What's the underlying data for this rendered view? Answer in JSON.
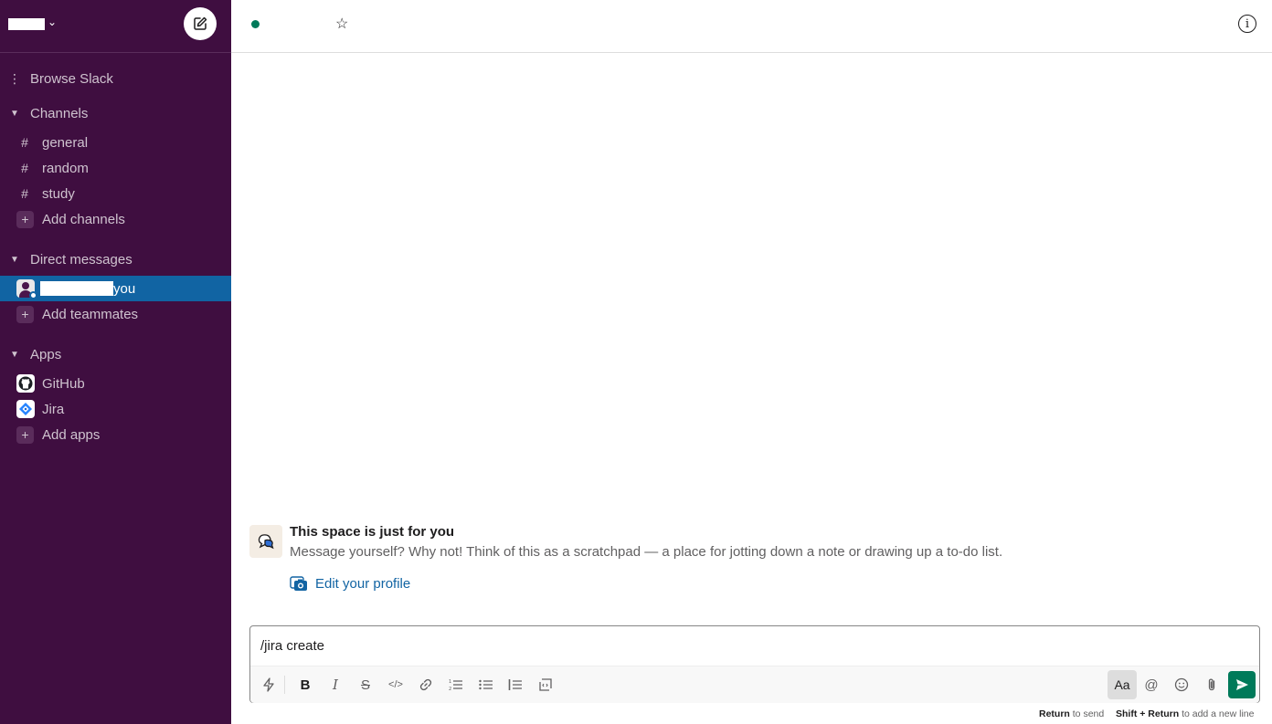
{
  "sidebar": {
    "browse": "Browse Slack",
    "channels_header": "Channels",
    "channels": [
      "general",
      "random",
      "study"
    ],
    "add_channels": "Add channels",
    "dm_header": "Direct messages",
    "dm_self_suffix": "you",
    "add_teammates": "Add teammates",
    "apps_header": "Apps",
    "apps": [
      "GitHub",
      "Jira"
    ],
    "add_apps": "Add apps"
  },
  "intro": {
    "title": "This space is just for you",
    "text": "Message yourself? Why not! Think of this as a scratchpad — a place for jotting down a note or drawing up a to-do list.",
    "edit_profile": "Edit your profile"
  },
  "composer": {
    "text": "/jira create",
    "aa_label": "Aa"
  },
  "hints": {
    "return_key": "Return",
    "return_action": "to send",
    "shift_key": "Shift + Return",
    "shift_action": "to add a new line"
  },
  "icons": {
    "hash": "#",
    "plus": "+",
    "menu": "⋮",
    "caret": "▼",
    "star": "☆",
    "info": "i"
  },
  "colors": {
    "sidebar_bg": "#3f0e40",
    "active_bg": "#1164a3",
    "presence_online": "#007a5a",
    "send_button": "#007a5a",
    "link": "#1264a3"
  }
}
